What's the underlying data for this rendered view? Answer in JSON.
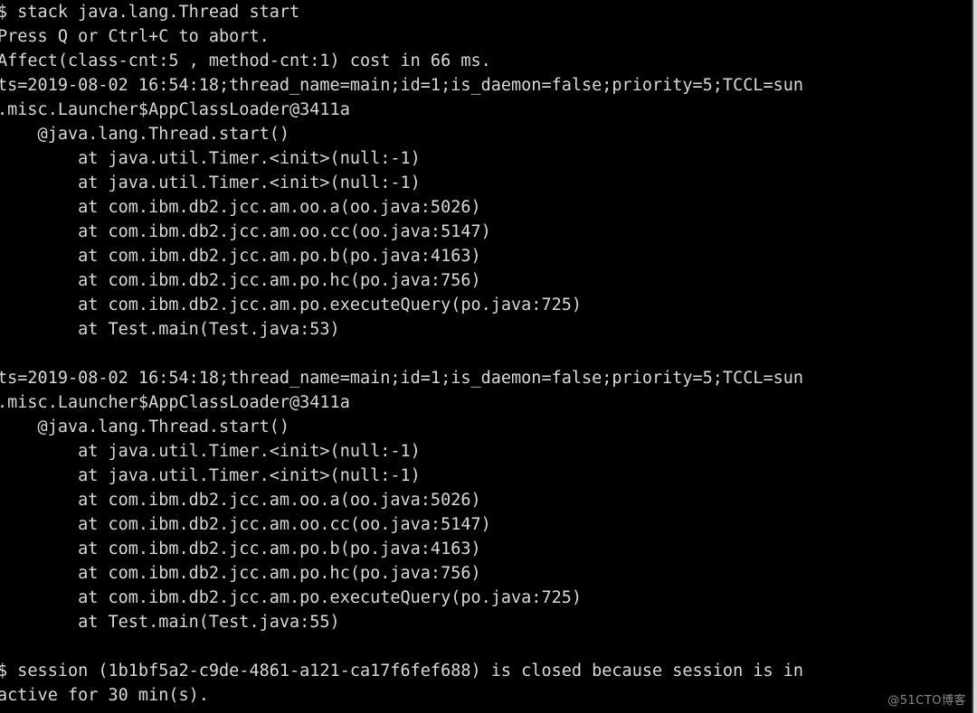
{
  "terminal": {
    "background_color": "#000000",
    "text_color": "#d8d8d8",
    "watermark": "@51CTO博客",
    "watermark_color": "#8a8a8a",
    "lines": [
      "$ stack java.lang.Thread start",
      "Press Q or Ctrl+C to abort.",
      "Affect(class-cnt:5 , method-cnt:1) cost in 66 ms.",
      "ts=2019-08-02 16:54:18;thread_name=main;id=1;is_daemon=false;priority=5;TCCL=sun",
      ".misc.Launcher$AppClassLoader@3411a",
      "    @java.lang.Thread.start()",
      "        at java.util.Timer.<init>(null:-1)",
      "        at java.util.Timer.<init>(null:-1)",
      "        at com.ibm.db2.jcc.am.oo.a(oo.java:5026)",
      "        at com.ibm.db2.jcc.am.oo.cc(oo.java:5147)",
      "        at com.ibm.db2.jcc.am.po.b(po.java:4163)",
      "        at com.ibm.db2.jcc.am.po.hc(po.java:756)",
      "        at com.ibm.db2.jcc.am.po.executeQuery(po.java:725)",
      "        at Test.main(Test.java:53)",
      "",
      "ts=2019-08-02 16:54:18;thread_name=main;id=1;is_daemon=false;priority=5;TCCL=sun",
      ".misc.Launcher$AppClassLoader@3411a",
      "    @java.lang.Thread.start()",
      "        at java.util.Timer.<init>(null:-1)",
      "        at java.util.Timer.<init>(null:-1)",
      "        at com.ibm.db2.jcc.am.oo.a(oo.java:5026)",
      "        at com.ibm.db2.jcc.am.oo.cc(oo.java:5147)",
      "        at com.ibm.db2.jcc.am.po.b(po.java:4163)",
      "        at com.ibm.db2.jcc.am.po.hc(po.java:756)",
      "        at com.ibm.db2.jcc.am.po.executeQuery(po.java:725)",
      "        at Test.main(Test.java:55)",
      "",
      "$ session (1b1bf5a2-c9de-4861-a121-ca17f6fef688) is closed because session is in",
      "active for 30 min(s)."
    ],
    "command": "stack java.lang.Thread start",
    "abort_hint": "Press Q or Ctrl+C to abort.",
    "affect_summary": "Affect(class-cnt:5 , method-cnt:1) cost in 66 ms.",
    "session_id": "1b1bf5a2-c9de-4861-a121-ca17f6fef688",
    "session_timeout_minutes": "30",
    "prompt_symbol": "$",
    "thread_info": {
      "timestamp": "2019-08-02 16:54:18",
      "thread_name": "main",
      "id": "1",
      "is_daemon": "false",
      "priority": "5",
      "tccl": "sun.misc.Launcher$AppClassLoader@3411a"
    }
  }
}
